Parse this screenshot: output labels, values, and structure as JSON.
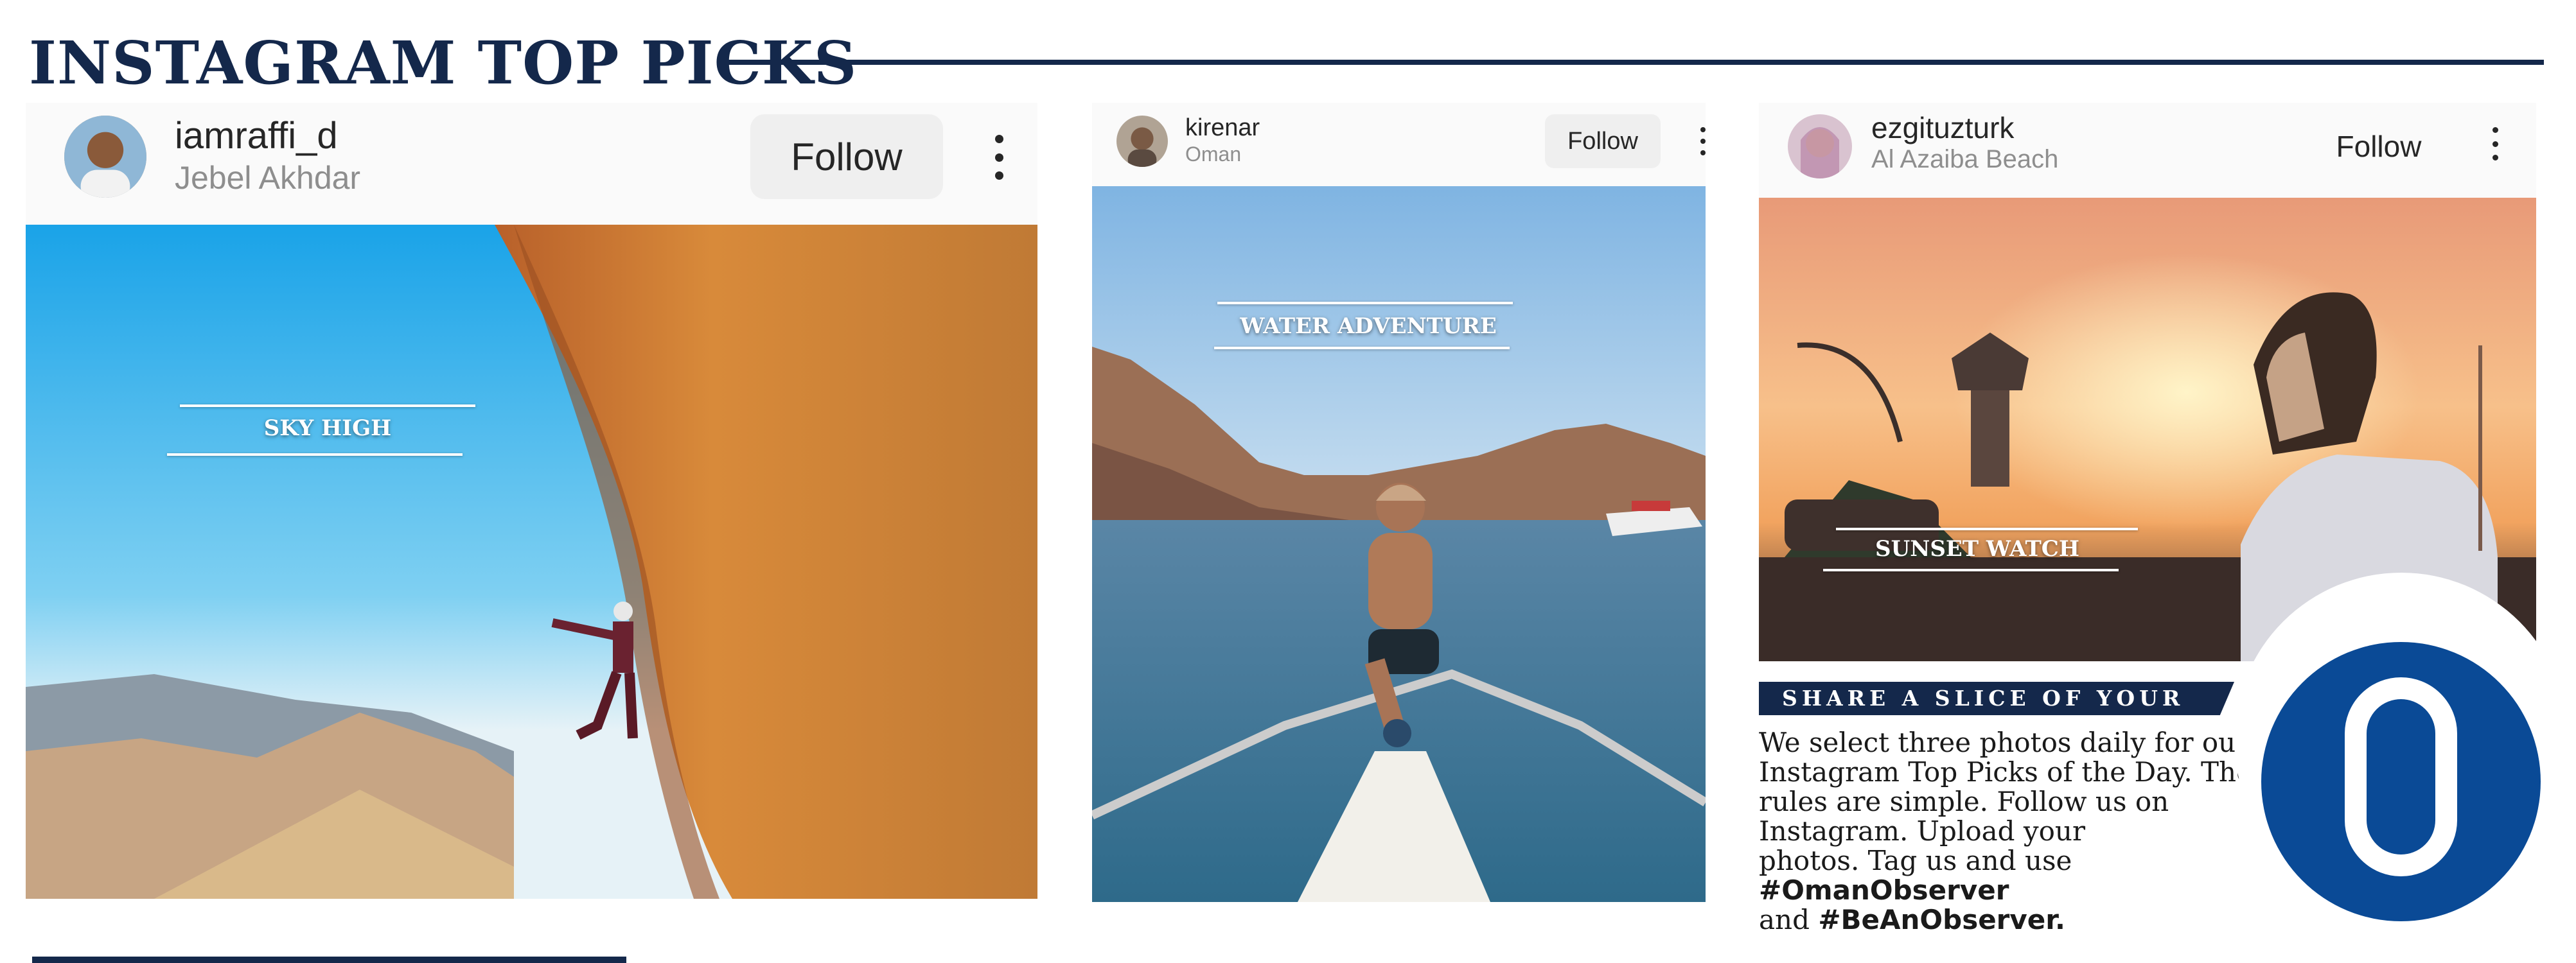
{
  "page": {
    "title": "INSTAGRAM TOP PICKS",
    "colors": {
      "navy": "#14284b",
      "logo_blue": "#0a4a96"
    }
  },
  "posts": [
    {
      "username": "iamraffi_d",
      "location": "Jebel Akhdar",
      "follow_label": "Follow",
      "caption": "SKY HIGH",
      "icons": {
        "avatar": "avatar",
        "more": "more-options-icon"
      }
    },
    {
      "username": "kirenar",
      "location": "Oman",
      "follow_label": "Follow",
      "caption": "WATER ADVENTURE",
      "icons": {
        "avatar": "avatar",
        "more": "more-options-icon"
      }
    },
    {
      "username": "ezgituzturk",
      "location": "Al Azaiba Beach",
      "follow_label": "Follow",
      "caption": "SUNSET WATCH",
      "icons": {
        "avatar": "avatar",
        "more": "more-options-icon"
      }
    }
  ],
  "promo": {
    "banner": "SHARE A SLICE OF YOUR LIFE",
    "text_lines": [
      "We select three photos daily for our",
      "Instagram Top Picks of the Day. The",
      "rules are simple. Follow us on",
      "Instagram. Upload your",
      "photos. Tag us and use "
    ],
    "hashtag_1": "#OmanObserver",
    "and_word": "and ",
    "hashtag_2": "#BeAnObserver",
    "period": "."
  },
  "logo": {
    "icon": "observer-o-logo"
  }
}
